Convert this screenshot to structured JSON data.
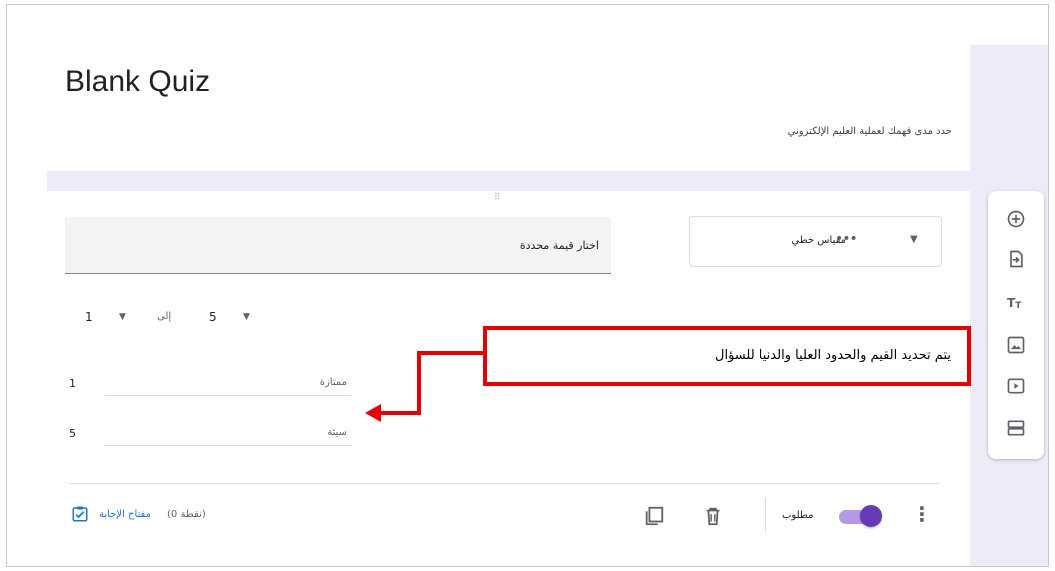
{
  "form": {
    "title": "Blank Quiz",
    "description": "حدد مدى فهمك لعملية العليم الإلكتروني"
  },
  "question": {
    "drag_handle": "⠿",
    "input_text": "اختار قيمة محددة",
    "type_label": "مقياس خطي",
    "type_icon": "•••",
    "type_caret": "▼"
  },
  "range": {
    "min": "1",
    "max": "5",
    "to_label": "إلى",
    "caret": "▼"
  },
  "scale_labels": [
    {
      "num": "1",
      "label": "ممتازة"
    },
    {
      "num": "5",
      "label": "سيئة"
    }
  ],
  "footer": {
    "answer_key": "مفتاح الإجابة",
    "points": "(نقطة 0)",
    "required": "مطلوب",
    "more": "⋮"
  },
  "callout": {
    "text": "يتم تحديد القيم والحدود العليا والدنيا للسؤال"
  },
  "colors": {
    "accent": "#673ab7",
    "callout_border": "#e60000",
    "link": "#1a73e8",
    "lavender": "#efeaf7"
  },
  "icons": {
    "toolbar": [
      "add-question-icon",
      "import-questions-icon",
      "add-title-icon",
      "add-image-icon",
      "add-video-icon",
      "add-section-icon"
    ]
  }
}
